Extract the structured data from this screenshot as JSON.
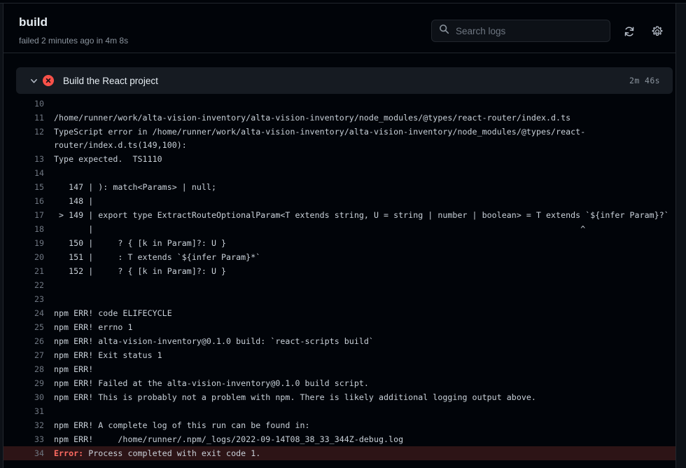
{
  "window": {
    "clipped_top_text": "··· ···· ···· ··· ···· ··· ··· ····· ····",
    "background": "#0d1117",
    "panel_background": "#010409",
    "accent_fail": "#f85149",
    "error_row_background": "#2d1416"
  },
  "header": {
    "job_title": "build",
    "job_status": "failed 2 minutes ago in 4m 8s",
    "search": {
      "placeholder": "Search logs",
      "value": "",
      "icon": "search-icon"
    },
    "refresh_icon": "refresh-icon",
    "settings_icon": "gear-icon"
  },
  "step": {
    "chevron_icon": "chevron-down-icon",
    "status_icon": "x-circle-icon",
    "title": "Build the React project",
    "duration": "2m 46s",
    "expanded": true
  },
  "log": {
    "lines": [
      {
        "n": "10",
        "text": ""
      },
      {
        "n": "11",
        "text": "/home/runner/work/alta-vision-inventory/alta-vision-inventory/node_modules/@types/react-router/index.d.ts"
      },
      {
        "n": "12",
        "text": "TypeScript error in /home/runner/work/alta-vision-inventory/alta-vision-inventory/node_modules/@types/react-router/index.d.ts(149,100):",
        "wrap": true
      },
      {
        "n": "13",
        "text": "Type expected.  TS1110"
      },
      {
        "n": "14",
        "text": ""
      },
      {
        "n": "15",
        "text": "   147 | ): match<Params> | null;"
      },
      {
        "n": "16",
        "text": "   148 |"
      },
      {
        "n": "17",
        "text": " > 149 | export type ExtractRouteOptionalParam<T extends string, U = string | number | boolean> = T extends `${infer Param}?`"
      },
      {
        "n": "18",
        "text": "       |                                                                                                   ^"
      },
      {
        "n": "19",
        "text": "   150 |     ? { [k in Param]?: U }"
      },
      {
        "n": "20",
        "text": "   151 |     : T extends `${infer Param}*`"
      },
      {
        "n": "21",
        "text": "   152 |     ? { [k in Param]?: U }"
      },
      {
        "n": "22",
        "text": ""
      },
      {
        "n": "23",
        "text": ""
      },
      {
        "n": "24",
        "text": "npm ERR! code ELIFECYCLE"
      },
      {
        "n": "25",
        "text": "npm ERR! errno 1"
      },
      {
        "n": "26",
        "text": "npm ERR! alta-vision-inventory@0.1.0 build: `react-scripts build`"
      },
      {
        "n": "27",
        "text": "npm ERR! Exit status 1"
      },
      {
        "n": "28",
        "text": "npm ERR!"
      },
      {
        "n": "29",
        "text": "npm ERR! Failed at the alta-vision-inventory@0.1.0 build script."
      },
      {
        "n": "30",
        "text": "npm ERR! This is probably not a problem with npm. There is likely additional logging output above."
      },
      {
        "n": "31",
        "text": ""
      },
      {
        "n": "32",
        "text": "npm ERR! A complete log of this run can be found in:"
      },
      {
        "n": "33",
        "text": "npm ERR!     /home/runner/.npm/_logs/2022-09-14T08_38_33_344Z-debug.log"
      },
      {
        "n": "34",
        "error": true,
        "tag": "Error:",
        "text": " Process completed with exit code 1."
      }
    ]
  }
}
